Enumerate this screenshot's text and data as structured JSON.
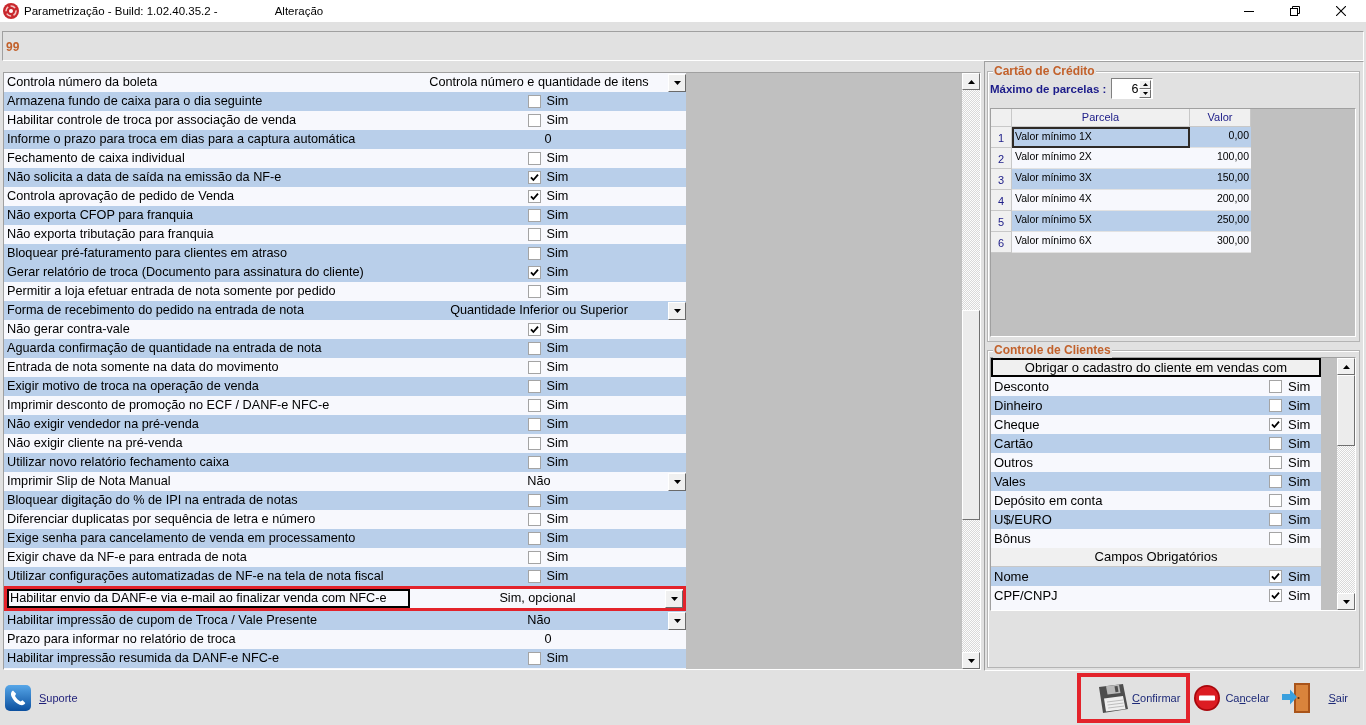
{
  "window": {
    "title": "Parametrização - Build: 1.02.40.35.2 -",
    "mode": "Alteração"
  },
  "header": {
    "code": "99"
  },
  "parameters": {
    "rows": [
      {
        "label": "Controla número da boleta",
        "kind": "dropdown",
        "value": "Controla número e quantidade de itens",
        "focused": false,
        "highlighted": false
      },
      {
        "label": "Armazena fundo de caixa para o dia seguinte",
        "kind": "checkbox",
        "checked": false,
        "option": "Sim",
        "focused": false,
        "highlighted": false
      },
      {
        "label": "Habilitar controle de troca por associação de venda",
        "kind": "checkbox",
        "checked": false,
        "option": "Sim",
        "focused": false,
        "highlighted": false
      },
      {
        "label": "Informe o prazo para troca em dias para a captura automática",
        "kind": "number",
        "value": "0",
        "focused": false,
        "highlighted": false
      },
      {
        "label": "Fechamento de caixa individual",
        "kind": "checkbox",
        "checked": false,
        "option": "Sim",
        "focused": false,
        "highlighted": false
      },
      {
        "label": "Não solicita a data de saída na emissão da NF-e",
        "kind": "checkbox",
        "checked": true,
        "option": "Sim",
        "focused": false,
        "highlighted": false
      },
      {
        "label": "Controla aprovação de pedido de Venda",
        "kind": "checkbox",
        "checked": true,
        "option": "Sim",
        "focused": false,
        "highlighted": false
      },
      {
        "label": "Não exporta CFOP para franquia",
        "kind": "checkbox",
        "checked": false,
        "option": "Sim",
        "focused": false,
        "highlighted": false
      },
      {
        "label": "Não exporta tributação para franquia",
        "kind": "checkbox",
        "checked": false,
        "option": "Sim",
        "focused": false,
        "highlighted": false
      },
      {
        "label": "Bloquear pré-faturamento para clientes em atraso",
        "kind": "checkbox",
        "checked": false,
        "option": "Sim",
        "focused": false,
        "highlighted": false
      },
      {
        "label": "Gerar relatório de troca (Documento para assinatura do cliente)",
        "kind": "checkbox",
        "checked": true,
        "option": "Sim",
        "focused": false,
        "highlighted": false
      },
      {
        "label": "Permitir a loja efetuar entrada de nota somente por pedido",
        "kind": "checkbox",
        "checked": false,
        "option": "Sim",
        "focused": false,
        "highlighted": false
      },
      {
        "label": "Forma de recebimento do pedido na entrada de nota",
        "kind": "dropdown",
        "value": "Quantidade Inferior ou Superior",
        "focused": false,
        "highlighted": false
      },
      {
        "label": "Não gerar contra-vale",
        "kind": "checkbox",
        "checked": true,
        "option": "Sim",
        "focused": false,
        "highlighted": false
      },
      {
        "label": "Aguarda confirmação de quantidade na entrada de nota",
        "kind": "checkbox",
        "checked": false,
        "option": "Sim",
        "focused": false,
        "highlighted": false
      },
      {
        "label": "Entrada de nota somente na data do movimento",
        "kind": "checkbox",
        "checked": false,
        "option": "Sim",
        "focused": false,
        "highlighted": false
      },
      {
        "label": "Exigir motivo de troca na operação de venda",
        "kind": "checkbox",
        "checked": false,
        "option": "Sim",
        "focused": false,
        "highlighted": false
      },
      {
        "label": "Imprimir desconto de promoção no ECF / DANF-e NFC-e",
        "kind": "checkbox",
        "checked": false,
        "option": "Sim",
        "focused": false,
        "highlighted": false
      },
      {
        "label": "Não exigir vendedor na pré-venda",
        "kind": "checkbox",
        "checked": false,
        "option": "Sim",
        "focused": false,
        "highlighted": false
      },
      {
        "label": "Não exigir cliente na pré-venda",
        "kind": "checkbox",
        "checked": false,
        "option": "Sim",
        "focused": false,
        "highlighted": false
      },
      {
        "label": "Utilizar novo relatório fechamento caixa",
        "kind": "checkbox",
        "checked": false,
        "option": "Sim",
        "focused": false,
        "highlighted": false
      },
      {
        "label": "Imprimir Slip de Nota Manual",
        "kind": "dropdown",
        "value": "Não",
        "focused": false,
        "highlighted": false
      },
      {
        "label": "Bloquear digitação do % de IPI na entrada de notas",
        "kind": "checkbox",
        "checked": false,
        "option": "Sim",
        "focused": false,
        "highlighted": false
      },
      {
        "label": "Diferenciar duplicatas por sequência de letra e número",
        "kind": "checkbox",
        "checked": false,
        "option": "Sim",
        "focused": false,
        "highlighted": false
      },
      {
        "label": "Exige senha para cancelamento de venda em processamento",
        "kind": "checkbox",
        "checked": false,
        "option": "Sim",
        "focused": false,
        "highlighted": false
      },
      {
        "label": "Exigir chave da NF-e para entrada de nota",
        "kind": "checkbox",
        "checked": false,
        "option": "Sim",
        "focused": false,
        "highlighted": false
      },
      {
        "label": "Utilizar configurações automatizadas de NF-e na tela de nota fiscal",
        "kind": "checkbox",
        "checked": false,
        "option": "Sim",
        "focused": false,
        "highlighted": false
      },
      {
        "label": "Habilitar envio da DANF-e via e-mail ao finalizar venda com NFC-e",
        "kind": "dropdown",
        "value": "Sim, opcional",
        "focused": true,
        "highlighted": true
      },
      {
        "label": "Habilitar impressão de cupom de Troca / Vale Presente",
        "kind": "dropdown",
        "value": "Não",
        "focused": false,
        "highlighted": false
      },
      {
        "label": "Prazo para informar no relatório de troca",
        "kind": "number",
        "value": "0",
        "focused": false,
        "highlighted": false
      },
      {
        "label": "Habilitar impressão resumida da DANF-e NFC-e",
        "kind": "checkbox",
        "checked": false,
        "option": "Sim",
        "focused": false,
        "highlighted": false
      }
    ]
  },
  "credit_card": {
    "title": "Cartão de Crédito",
    "max_installments": {
      "label": "Máximo de parcelas :",
      "value": "6"
    },
    "table": {
      "columns": [
        "Parcela",
        "Valor"
      ],
      "rows": [
        {
          "number": "1",
          "parcela": "Valor mínimo 1X",
          "valor": "0,00",
          "focused": true
        },
        {
          "number": "2",
          "parcela": "Valor mínimo 2X",
          "valor": "100,00",
          "focused": false
        },
        {
          "number": "3",
          "parcela": "Valor mínimo 3X",
          "valor": "150,00",
          "focused": false
        },
        {
          "number": "4",
          "parcela": "Valor mínimo 4X",
          "valor": "200,00",
          "focused": false
        },
        {
          "number": "5",
          "parcela": "Valor mínimo 5X",
          "valor": "250,00",
          "focused": false
        },
        {
          "number": "6",
          "parcela": "Valor mínimo 6X",
          "valor": "300,00",
          "focused": false
        }
      ]
    }
  },
  "client_control": {
    "title": "Controle de Clientes",
    "sections": [
      {
        "heading": "Obrigar o cadastro do cliente em vendas com",
        "focused": true,
        "items": [
          {
            "label": "Desconto",
            "checked": false,
            "option": "Sim"
          },
          {
            "label": "Dinheiro",
            "checked": false,
            "option": "Sim"
          },
          {
            "label": "Cheque",
            "checked": true,
            "option": "Sim"
          },
          {
            "label": "Cartão",
            "checked": false,
            "option": "Sim"
          },
          {
            "label": "Outros",
            "checked": false,
            "option": "Sim"
          },
          {
            "label": "Vales",
            "checked": false,
            "option": "Sim"
          },
          {
            "label": "Depósito em conta",
            "checked": false,
            "option": "Sim"
          },
          {
            "label": "U$/EURO",
            "checked": false,
            "option": "Sim"
          },
          {
            "label": "Bônus",
            "checked": false,
            "option": "Sim"
          }
        ]
      },
      {
        "heading": "Campos Obrigatórios",
        "focused": false,
        "items": [
          {
            "label": "Nome",
            "checked": true,
            "option": "Sim"
          },
          {
            "label": "CPF/CNPJ",
            "checked": true,
            "option": "Sim"
          }
        ]
      }
    ]
  },
  "footer": {
    "support": {
      "label": [
        {
          "text": "S",
          "underlined": true
        },
        {
          "text": "uporte",
          "underlined": false
        }
      ]
    },
    "buttons": [
      {
        "kind": "confirm",
        "label": [
          {
            "text": "C",
            "underlined": true
          },
          {
            "text": "onfirmar",
            "underlined": false
          }
        ],
        "highlighted": true
      },
      {
        "kind": "cancel",
        "label": [
          {
            "text": "Ca",
            "underlined": false
          },
          {
            "text": "n",
            "underlined": true
          },
          {
            "text": "celar",
            "underlined": false
          }
        ],
        "highlighted": false
      },
      {
        "kind": "exit",
        "label": [
          {
            "text": "S",
            "underlined": true
          },
          {
            "text": "air",
            "underlined": false
          }
        ],
        "highlighted": false
      }
    ]
  }
}
